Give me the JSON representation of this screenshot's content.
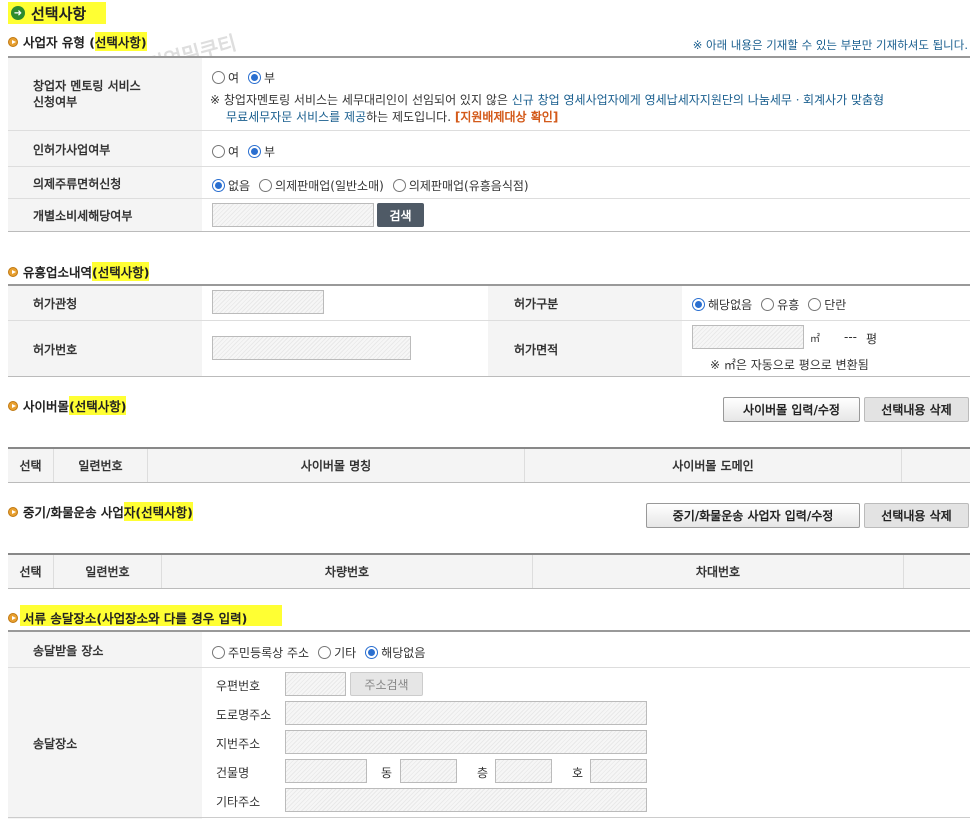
{
  "page_header": {
    "title": "선택사항"
  },
  "watermark": "리얼밀쿠티",
  "business_type": {
    "title_prefix": "사업자 유형 (",
    "title_highlight": "선택사항)",
    "notice": "※ 아래 내용은 기재할 수 있는 부분만 기재하셔도 됩니다.",
    "rows": {
      "mentoring": {
        "label_line1": "창업자 멘토링 서비스",
        "label_line2": "신청여부",
        "options": [
          "여",
          "부"
        ],
        "selected": "부",
        "note_prefix": "※ 창업자멘토링 서비스는 세무대리인이 선임되어 있지 않은 ",
        "note_blue1": "신규 창업 영세사업자에게 영세납세자지원단의 나눔세무ㆍ회계사가 맞춤형",
        "note_blue2": "무료세무자문 서비스를 제공",
        "note_suffix": "하는 제도입니다. ",
        "note_link": "[지원배제대상 확인]"
      },
      "license_business": {
        "label": "인허가사업여부",
        "options": [
          "여",
          "부"
        ],
        "selected": "부"
      },
      "liquor": {
        "label": "의제주류면허신청",
        "options": [
          "없음",
          "의제판매업(일반소매)",
          "의제판매업(유흥음식점)"
        ],
        "selected": "없음"
      },
      "excise": {
        "label": "개별소비세해당여부",
        "search_button": "검색"
      }
    }
  },
  "entertainment": {
    "title_prefix": "유흥업소내역",
    "title_highlight": "(선택사항)",
    "permit_office_label": "허가관청",
    "permit_type_label": "허가구분",
    "permit_type_options": [
      "해당없음",
      "유흥",
      "단란"
    ],
    "permit_type_selected": "해당없음",
    "permit_number_label": "허가번호",
    "permit_area_label": "허가면적",
    "area_unit": "㎡",
    "pyeong_value": "---",
    "pyeong_unit": "평",
    "area_note": "※ ㎡은 자동으로 평으로 변환됨"
  },
  "cyber_mall": {
    "title_prefix": "사이버몰",
    "title_highlight": "(선택사항)",
    "input_button": "사이버몰 입력/수정",
    "delete_button": "선택내용 삭제",
    "columns": [
      "선택",
      "일련번호",
      "사이버몰 명칭",
      "사이버몰 도메인"
    ]
  },
  "freight": {
    "title_prefix": "중기/화물운송 사업",
    "title_highlight": "자(선택사항)",
    "input_button": "중기/화물운송 사업자 입력/수정",
    "delete_button": "선택내용 삭제",
    "columns": [
      "선택",
      "일련번호",
      "차량번호",
      "차대번호"
    ]
  },
  "delivery": {
    "title": "서류 송달장소(사업장소와 다를 경우 입력)",
    "place_label": "송달받을 장소",
    "place_options": [
      "주민등록상 주소",
      "기타",
      "해당없음"
    ],
    "place_selected": "해당없음",
    "address_label": "송달장소",
    "postal_label": "우편번호",
    "address_search_button": "주소검색",
    "road_label": "도로명주소",
    "lot_label": "지번주소",
    "building_label": "건물명",
    "dong_label": "동",
    "floor_label": "층",
    "ho_label": "호",
    "other_label": "기타주소"
  }
}
